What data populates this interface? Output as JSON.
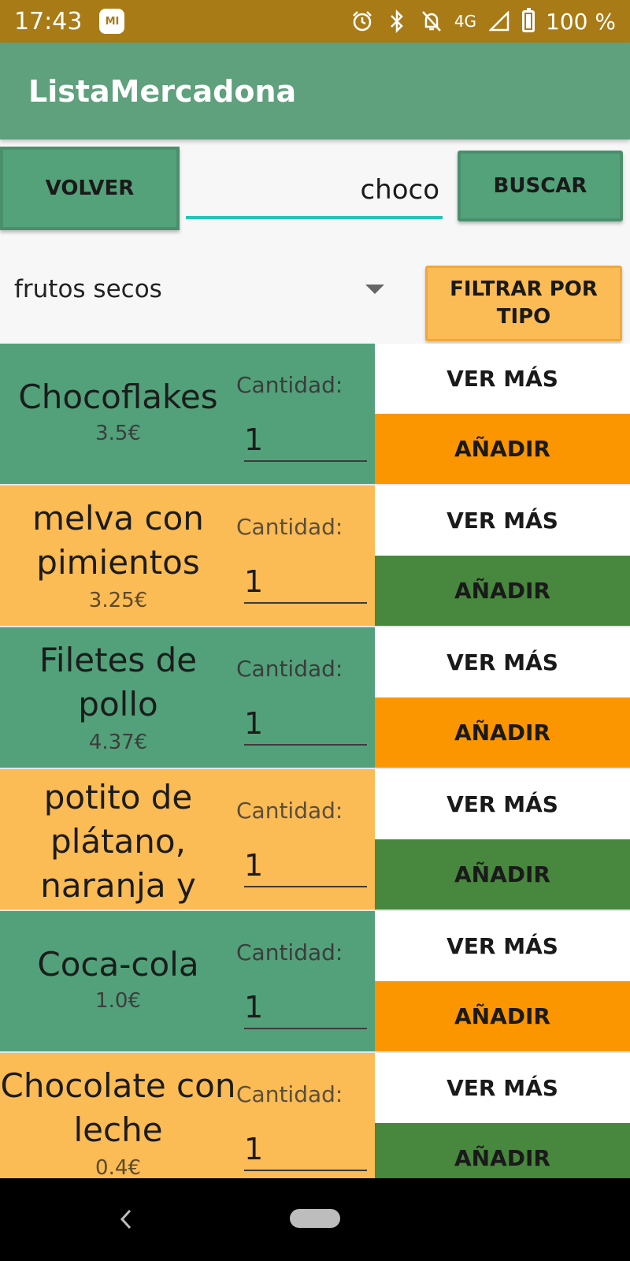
{
  "status_bar": {
    "time": "17:43",
    "app_icon_label": "MI",
    "icons": [
      "alarm-icon",
      "bluetooth-icon",
      "notifications-off-icon",
      "signal-icon",
      "battery-icon"
    ],
    "network": "4G",
    "battery": "100 %"
  },
  "app_bar": {
    "title": "ListaMercadona"
  },
  "controls": {
    "back_label": "VOLVER",
    "search_value": "choco",
    "search_label": "BUSCAR",
    "type_selected": "frutos secos",
    "filter_label": "FILTRAR POR TIPO"
  },
  "products": [
    {
      "name": "Chocoflakes",
      "price": "3.5€",
      "quantity_label": "Cantidad:",
      "quantity": "1",
      "more_label": "VER MÁS",
      "add_label": "AÑADIR"
    },
    {
      "name": "melva con pimientos",
      "price": "3.25€",
      "quantity_label": "Cantidad:",
      "quantity": "1",
      "more_label": "VER MÁS",
      "add_label": "AÑADIR"
    },
    {
      "name": "Filetes de pollo",
      "price": "4.37€",
      "quantity_label": "Cantidad:",
      "quantity": "1",
      "more_label": "VER MÁS",
      "add_label": "AÑADIR"
    },
    {
      "name": "potito de plátano, naranja y",
      "price": "",
      "quantity_label": "Cantidad:",
      "quantity": "1",
      "more_label": "VER MÁS",
      "add_label": "AÑADIR"
    },
    {
      "name": "Coca-cola",
      "price": "1.0€",
      "quantity_label": "Cantidad:",
      "quantity": "1",
      "more_label": "VER MÁS",
      "add_label": "AÑADIR"
    },
    {
      "name": "Chocolate con leche",
      "price": "0.4€",
      "quantity_label": "Cantidad:",
      "quantity": "1",
      "more_label": "VER MÁS",
      "add_label": "AÑADIR"
    }
  ],
  "colors": {
    "status_bar": "#a97b16",
    "app_bar": "#5fa07d",
    "green_row": "#52a17a",
    "yellow_row": "#fbbb55",
    "add_orange": "#fc9600",
    "add_green": "#48873e",
    "search_underline": "#26c6b4"
  },
  "nav_bar": {
    "icons": [
      "back-icon",
      "home-pill-icon"
    ]
  }
}
